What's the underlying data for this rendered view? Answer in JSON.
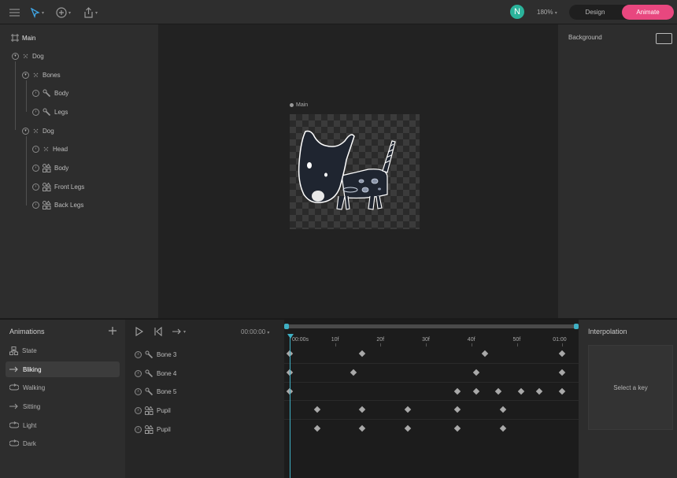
{
  "toolbar": {
    "avatar_initial": "N",
    "zoom": "180%",
    "mode_design": "Design",
    "mode_animate": "Animate",
    "accent": "#e8477f"
  },
  "hierarchy": {
    "items": [
      {
        "label": "Main",
        "icon": "artboard-icon"
      },
      {
        "label": "Dog",
        "icon": "node-icon"
      },
      {
        "label": "Bones",
        "icon": "node-icon"
      },
      {
        "label": "Body",
        "icon": "bone-icon"
      },
      {
        "label": "Legs",
        "icon": "bone-icon"
      },
      {
        "label": "Dog",
        "icon": "node-icon"
      },
      {
        "label": "Head",
        "icon": "node-icon"
      },
      {
        "label": "Body",
        "icon": "shapes-icon"
      },
      {
        "label": "Front Legs",
        "icon": "shapes-icon"
      },
      {
        "label": "Back Legs",
        "icon": "shapes-icon"
      }
    ]
  },
  "stage": {
    "artboard_label": "Main"
  },
  "inspector": {
    "background_label": "Background"
  },
  "animations": {
    "title": "Animations",
    "items": [
      {
        "label": "State",
        "icon": "state-icon"
      },
      {
        "label": "Bliking",
        "icon": "oneshot-icon",
        "active": true
      },
      {
        "label": "Walking",
        "icon": "loop-icon"
      },
      {
        "label": "Sitting",
        "icon": "oneshot-icon"
      },
      {
        "label": "Light",
        "icon": "loop-icon"
      },
      {
        "label": "Dark",
        "icon": "loop-icon"
      }
    ]
  },
  "playback": {
    "timecode": "00:00:00"
  },
  "tracks": [
    {
      "label": "Bone 3",
      "icon": "bone-icon",
      "keys": [
        0,
        16,
        43,
        60
      ]
    },
    {
      "label": "Bone 4",
      "icon": "bone-icon",
      "keys": [
        0,
        14,
        41,
        60
      ]
    },
    {
      "label": "Bone 5",
      "icon": "bone-icon",
      "keys": [
        0,
        37,
        41,
        46,
        51,
        55,
        60
      ]
    },
    {
      "label": "Pupil",
      "icon": "shapes-icon",
      "keys": [
        6,
        16,
        26,
        37,
        47
      ]
    },
    {
      "label": "Pupil",
      "icon": "shapes-icon",
      "keys": [
        6,
        16,
        26,
        37,
        47
      ]
    }
  ],
  "ruler": {
    "labels": [
      "00:00s",
      "10f",
      "20f",
      "30f",
      "40f",
      "50f",
      "01:00"
    ],
    "frames": [
      0,
      10,
      20,
      30,
      40,
      50,
      60
    ]
  },
  "interpolation": {
    "title": "Interpolation",
    "hint": "Select a key"
  }
}
